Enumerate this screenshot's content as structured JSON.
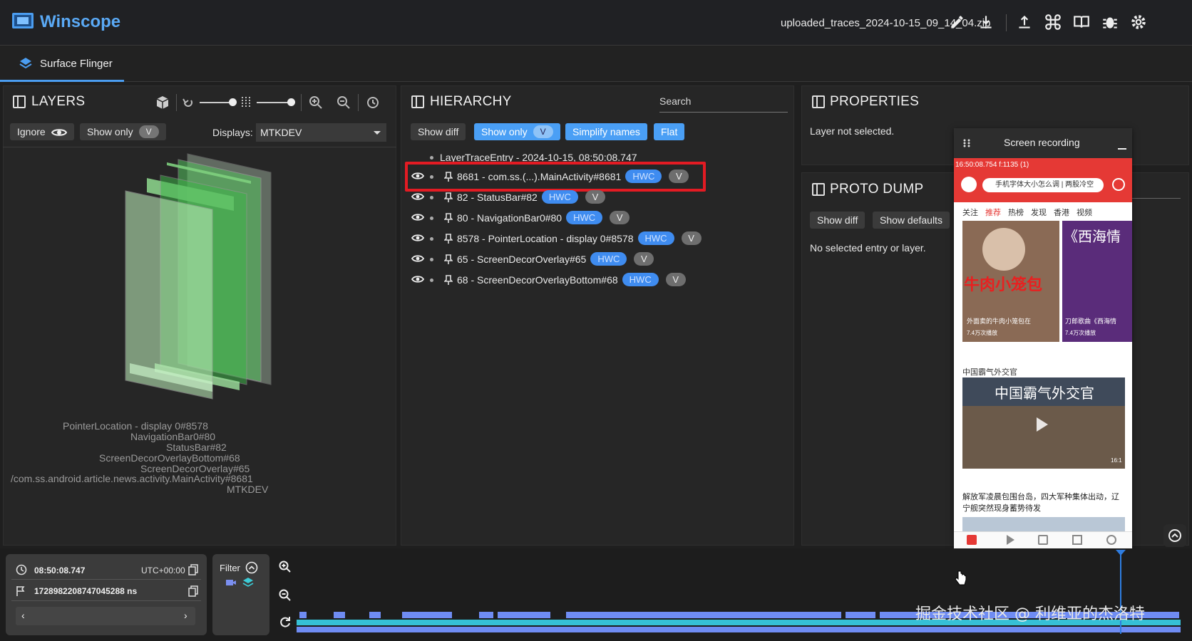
{
  "app": {
    "title": "Winscope",
    "filename": "uploaded_traces_2024-10-15_09_14_04.zip"
  },
  "toolbar_icons": [
    "edit-icon",
    "download-icon",
    "upload-icon",
    "command-icon",
    "book-icon",
    "bug-icon",
    "settings-icon"
  ],
  "tabs": [
    {
      "label": "Surface Flinger",
      "active": true
    }
  ],
  "layers": {
    "title": "LAYERS",
    "ignore_label": "Ignore",
    "show_only_label": "Show only",
    "v_badge": "V",
    "displays_label": "Displays:",
    "display_value": "MTKDEV",
    "labels": [
      "PointerLocation - display 0#8578",
      "NavigationBar0#80",
      "StatusBar#82",
      "ScreenDecorOverlayBottom#68",
      "ScreenDecorOverlay#65",
      "/com.ss.android.article.news.activity.MainActivity#8681",
      "MTKDEV"
    ]
  },
  "hierarchy": {
    "title": "HIERARCHY",
    "search_placeholder": "Search",
    "show_diff": "Show diff",
    "show_only": "Show only",
    "v_badge": "V",
    "simplify_names": "Simplify names",
    "flat": "Flat",
    "root": "LayerTraceEntry - 2024-10-15, 08:50:08.747",
    "rows": [
      {
        "name": "8681 - com.ss.(...).MainActivity#8681",
        "hwc": "HWC",
        "v": "V",
        "highlighted": true
      },
      {
        "name": "82 - StatusBar#82",
        "hwc": "HWC",
        "v": "V"
      },
      {
        "name": "80 - NavigationBar0#80",
        "hwc": "HWC",
        "v": "V"
      },
      {
        "name": "8578 - PointerLocation - display 0#8578",
        "hwc": "HWC",
        "v": "V"
      },
      {
        "name": "65 - ScreenDecorOverlay#65",
        "hwc": "HWC",
        "v": "V"
      },
      {
        "name": "68 - ScreenDecorOverlayBottom#68",
        "hwc": "HWC",
        "v": "V"
      }
    ]
  },
  "properties": {
    "title": "PROPERTIES",
    "empty_text": "Layer not selected."
  },
  "proto_dump": {
    "title": "PROTO DUMP",
    "show_diff": "Show diff",
    "show_defaults": "Show defaults",
    "empty_text": "No selected entry or layer."
  },
  "recording": {
    "title": "Screen recording",
    "status_time": "16:50:08.754 f:1135 (1)",
    "search_text": "手机字体大小怎么调 | 两股冷空",
    "nav_tabs": [
      "关注",
      "推荐",
      "热榜",
      "发现",
      "香港",
      "视频"
    ],
    "card1_title": "牛肉小笼包",
    "card1_caption": "外面卖的牛肉小笼包在",
    "card1_views": "7.4万次播放",
    "card2_title": "《西海情",
    "card2_caption": "刀郎歌曲《西海情",
    "card2_views": "7.4万次播放",
    "section_title": "中国霸气外交官",
    "video_overlay_title": "中国霸气外交官",
    "video_duration": "16:1",
    "news_headline": "解放军凌晨包围台岛，四大军种集体出动，辽宁舰突然现身蓄势待发"
  },
  "timeline": {
    "time_text": "08:50:08.747",
    "utc_text": "UTC+00:00",
    "ns_text": "1728982208747045288 ns",
    "filter_label": "Filter"
  },
  "watermark": "掘金技术社区 @ 利维亚的杰洛特",
  "colors": {
    "accent": "#4a9ff5",
    "highlight_border": "#e31b23",
    "hwc": "#3f8cf0",
    "timeline_bar": "#6f8cf3",
    "timeline_bar2": "#36c0d6"
  }
}
